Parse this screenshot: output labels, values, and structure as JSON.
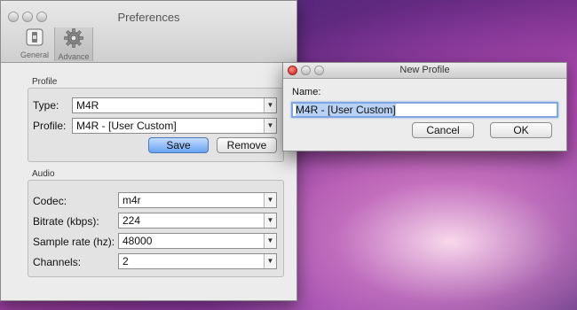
{
  "preferences": {
    "title": "Preferences",
    "toolbar": [
      {
        "label": "General",
        "icon": "switch-icon"
      },
      {
        "label": "Advance",
        "icon": "gear-icon"
      }
    ],
    "profile_section": {
      "title": "Profile",
      "type_label": "Type:",
      "type_value": "M4R",
      "profile_label": "Profile:",
      "profile_value": "M4R - [User Custom]",
      "save_label": "Save",
      "remove_label": "Remove"
    },
    "audio_section": {
      "title": "Audio",
      "codec_label": "Codec:",
      "codec_value": "m4r",
      "bitrate_label": "Bitrate (kbps):",
      "bitrate_value": "224",
      "samplerate_label": "Sample rate (hz):",
      "samplerate_value": "48000",
      "channels_label": "Channels:",
      "channels_value": "2"
    }
  },
  "new_profile_dialog": {
    "title": "New Profile",
    "name_label": "Name:",
    "name_value": "M4R - [User Custom]",
    "cancel_label": "Cancel",
    "ok_label": "OK"
  },
  "colors": {
    "close_red": "#e0443e",
    "primary_blue": "#6aa3f2",
    "focus_ring": "#7fa6e2"
  }
}
